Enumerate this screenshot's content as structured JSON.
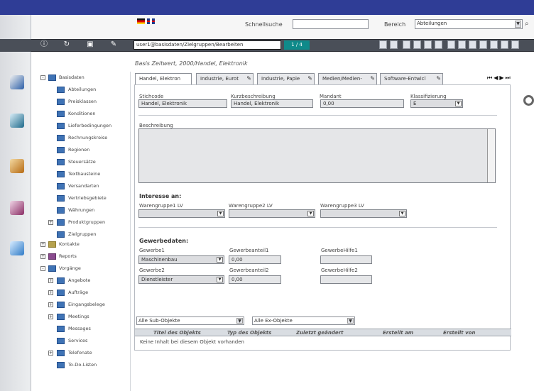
{
  "header": {
    "quick_search_label": "Schnellsuche",
    "area_label": "Bereich",
    "area_value": "Abteilungen",
    "path_select": "user1@basisdaten/Zielgruppen/Bearbeiten",
    "pager": "1 / 4"
  },
  "breadcrumb": "Basis Zeitwert, 2000/Handel, Elektronik",
  "tabs": [
    {
      "label": "Handel, Elektron"
    },
    {
      "label": "Industrie, Eurot"
    },
    {
      "label": "Industrie, Papie"
    },
    {
      "label": "Medien/Medien-"
    },
    {
      "label": "Software-Entwicl"
    }
  ],
  "form": {
    "kurzcode_label": "Stichcode",
    "kurzcode_value": "Handel, Elektronik",
    "kurz_label": "Kurzbeschreibung",
    "kurz_value": "Handel, Elektronik",
    "mandant_label": "Mandant",
    "mandant_value": "0,00",
    "klasse_label": "Klassifizierung",
    "klasse_value": "E",
    "beschreibung_label": "Beschreibung",
    "interessen_title": "Interesse an:",
    "wg1_label": "Warengruppe1 LV",
    "wg2_label": "Warengruppe2 LV",
    "wg3_label": "Warengruppe3 LV",
    "gewerbe_title": "Gewerbedaten:",
    "gewerbe1_label": "Gewerbe1",
    "gewerbe1_value": "Maschinenbau",
    "anteil1_label": "Gewerbeanteil1",
    "anteil1_value": "0,00",
    "gewerbe2_label": "Gewerbe2",
    "gewerbe2_value": "Dienstleister",
    "anteil2_label": "Gewerbeanteil2",
    "anteil2_value": "0,00",
    "gewerbe_hinweis1_label": "GewerbeHilfe1",
    "gewerbe_hinweis2_label": "GewerbeHilfe2"
  },
  "table": {
    "filter1": "Alle Sub-Objekte",
    "filter2": "Alle Ex-Objekte",
    "headers": [
      "Titel des Objekts",
      "Typ des Objekts",
      "Zuletzt geändert",
      "Erstellt am",
      "Erstellt von"
    ],
    "empty_text": "Keine Inhalt bei diesem Objekt vorhanden"
  },
  "tree": {
    "root": "Basisdaten",
    "items": [
      "Abteilungen",
      "Preisklassen",
      "Konditionen",
      "Lieferbedingungen",
      "Rechnungskreise",
      "Regionen",
      "Steuersätze",
      "Textbausteine",
      "Versandarten",
      "Vertriebsgebiete",
      "Währungen",
      "Produktgruppen",
      "Zielgruppen"
    ],
    "kontakte": "Kontakte",
    "reports": "Reports",
    "vorgänge": "Vorgänge",
    "vorgänge_items": [
      "Angebote",
      "Aufträge",
      "Eingangsbelege",
      "Meetings",
      "Messages",
      "Services",
      "Telefonate",
      "To-Do-Listen"
    ]
  }
}
